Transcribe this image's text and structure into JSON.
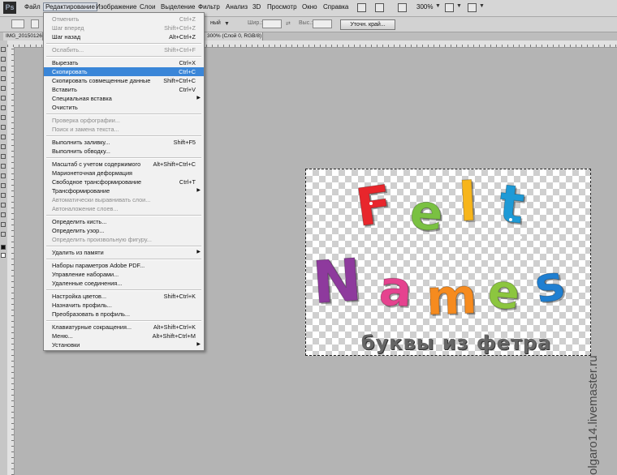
{
  "app": {
    "logo": "Ps"
  },
  "menubar": {
    "items": [
      "Файл",
      "Редактирование",
      "Изображение",
      "Слои",
      "Выделение",
      "Фильтр",
      "Анализ",
      "3D",
      "Просмотр",
      "Окно",
      "Справка"
    ],
    "zoom": "300%"
  },
  "options_bar": {
    "style_value": "ный",
    "width_label": "Шир.:",
    "height_label": "Выс.:",
    "refine_edge_button": "Уточн. край..."
  },
  "document_tabs": [
    {
      "title": "IMG_20150126"
    },
    {
      "title": "300% (Слой 0, RGB/8)"
    }
  ],
  "canvas": {
    "word1": [
      "F",
      "e",
      "l",
      "t"
    ],
    "word2": [
      "N",
      "a",
      "m",
      "e",
      "s"
    ],
    "subtitle": "буквы из фетра",
    "colors": {
      "F": "#e8262c",
      "e1": "#7ac142",
      "l": "#f7b51b",
      "t": "#1e9ad6",
      "N": "#8e3a9d",
      "a": "#e5438f",
      "m": "#f68b1f",
      "e2": "#8cc63f",
      "s": "#1f7fd1"
    }
  },
  "watermark": "olgaro14.livemaster.ru",
  "edit_menu": {
    "items": [
      {
        "type": "item",
        "label": "Отменить",
        "shortcut": "Ctrl+Z",
        "disabled": true
      },
      {
        "type": "item",
        "label": "Шаг вперед",
        "shortcut": "Shift+Ctrl+Z",
        "disabled": true
      },
      {
        "type": "item",
        "label": "Шаг назад",
        "shortcut": "Alt+Ctrl+Z",
        "disabled": false
      },
      {
        "type": "separator"
      },
      {
        "type": "item",
        "label": "Ослабить...",
        "shortcut": "Shift+Ctrl+F",
        "disabled": true
      },
      {
        "type": "separator"
      },
      {
        "type": "item",
        "label": "Вырезать",
        "shortcut": "Ctrl+X",
        "disabled": false
      },
      {
        "type": "item",
        "label": "Скопировать",
        "shortcut": "Ctrl+C",
        "disabled": false,
        "highlighted": true
      },
      {
        "type": "item",
        "label": "Скопировать совмещенные данные",
        "shortcut": "Shift+Ctrl+C",
        "disabled": false
      },
      {
        "type": "item",
        "label": "Вставить",
        "shortcut": "Ctrl+V",
        "disabled": false
      },
      {
        "type": "item",
        "label": "Специальная вставка",
        "submenu": true,
        "disabled": false
      },
      {
        "type": "item",
        "label": "Очистить",
        "disabled": false
      },
      {
        "type": "separator"
      },
      {
        "type": "item",
        "label": "Проверка орфографии...",
        "disabled": true
      },
      {
        "type": "item",
        "label": "Поиск и замена текста...",
        "disabled": true
      },
      {
        "type": "separator"
      },
      {
        "type": "item",
        "label": "Выполнить заливку...",
        "shortcut": "Shift+F5",
        "disabled": false
      },
      {
        "type": "item",
        "label": "Выполнить обводку...",
        "disabled": false
      },
      {
        "type": "separator"
      },
      {
        "type": "item",
        "label": "Масштаб с учетом содержимого",
        "shortcut": "Alt+Shift+Ctrl+C",
        "disabled": false
      },
      {
        "type": "item",
        "label": "Марионеточная деформация",
        "disabled": false
      },
      {
        "type": "item",
        "label": "Свободное трансформирование",
        "shortcut": "Ctrl+T",
        "disabled": false
      },
      {
        "type": "item",
        "label": "Трансформирование",
        "submenu": true,
        "disabled": false
      },
      {
        "type": "item",
        "label": "Автоматически выравнивать слои...",
        "disabled": true
      },
      {
        "type": "item",
        "label": "Автоналожение слоев...",
        "disabled": true
      },
      {
        "type": "separator"
      },
      {
        "type": "item",
        "label": "Определить кисть...",
        "disabled": false
      },
      {
        "type": "item",
        "label": "Определить узор...",
        "disabled": false
      },
      {
        "type": "item",
        "label": "Определить произвольную фигуру...",
        "disabled": true
      },
      {
        "type": "separator"
      },
      {
        "type": "item",
        "label": "Удалить из памяти",
        "submenu": true,
        "disabled": false
      },
      {
        "type": "separator"
      },
      {
        "type": "item",
        "label": "Наборы параметров Adobe PDF...",
        "disabled": false
      },
      {
        "type": "item",
        "label": "Управление наборами...",
        "disabled": false
      },
      {
        "type": "item",
        "label": "Удаленные соединения...",
        "disabled": false
      },
      {
        "type": "separator"
      },
      {
        "type": "item",
        "label": "Настройка цветов...",
        "shortcut": "Shift+Ctrl+K",
        "disabled": false
      },
      {
        "type": "item",
        "label": "Назначить профиль...",
        "disabled": false
      },
      {
        "type": "item",
        "label": "Преобразовать в профиль...",
        "disabled": false
      },
      {
        "type": "separator"
      },
      {
        "type": "item",
        "label": "Клавиатурные сокращения...",
        "shortcut": "Alt+Shift+Ctrl+K",
        "disabled": false
      },
      {
        "type": "item",
        "label": "Меню...",
        "shortcut": "Alt+Shift+Ctrl+M",
        "disabled": false
      },
      {
        "type": "item",
        "label": "Установки",
        "submenu": true,
        "disabled": false
      }
    ]
  }
}
